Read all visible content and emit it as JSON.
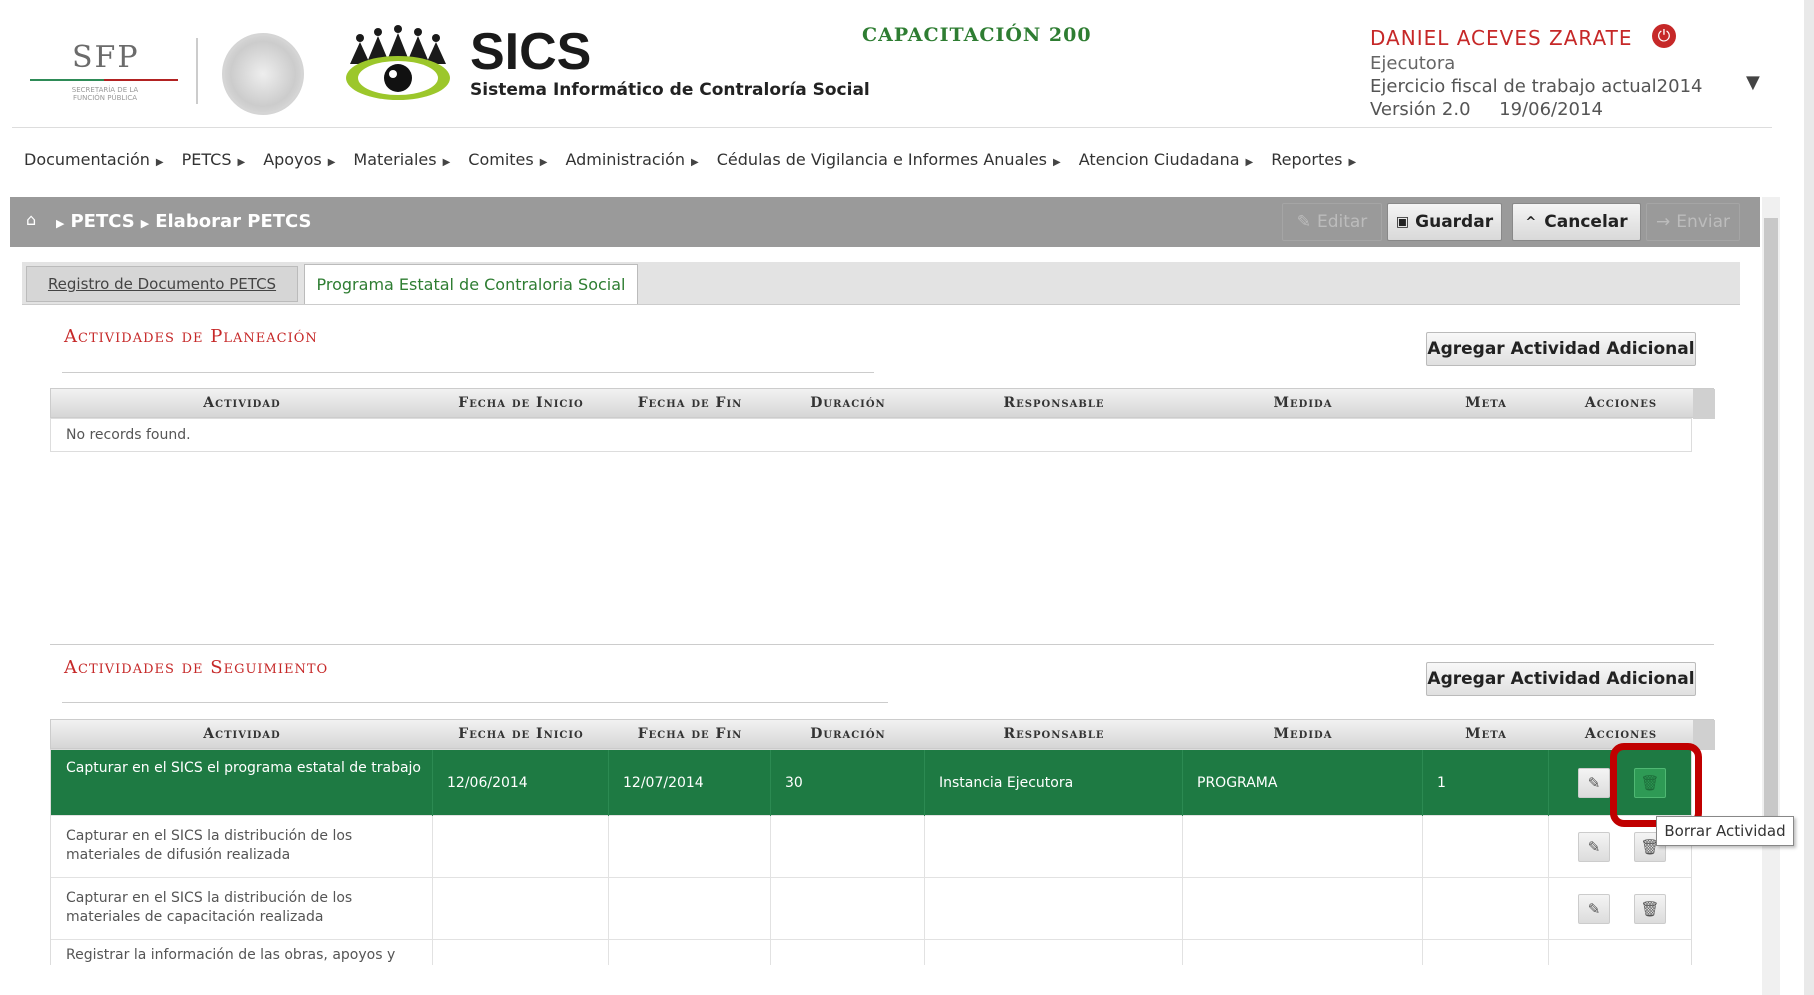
{
  "header": {
    "sfp_logo": "SFP",
    "sfp_subtitle": "SECRETARÍA DE LA FUNCIÓN PÚBLICA",
    "app_name": "SICS",
    "app_subtitle": "Sistema Informático de Contraloría Social",
    "environment": "CAPACITACIÓN 200"
  },
  "user": {
    "name": "DANIEL ACEVES ZARATE",
    "role": "Ejecutora",
    "fiscal": "Ejercicio fiscal de trabajo actual2014",
    "version": "Versión 2.0     19/06/2014"
  },
  "menu": [
    "Documentación",
    "PETCS",
    "Apoyos",
    "Materiales",
    "Comites",
    "Administración",
    "Cédulas de Vigilancia e Informes Anuales",
    "Atencion Ciudadana",
    "Reportes"
  ],
  "breadcrumb": {
    "level1": "PETCS",
    "level2": "Elaborar PETCS"
  },
  "toolbar": {
    "editar": "Editar",
    "guardar": "Guardar",
    "cancelar": "Cancelar",
    "enviar": "Enviar"
  },
  "tabs": {
    "tab1": "Registro de Documento PETCS",
    "tab2": "Programa Estatal de Contraloria Social"
  },
  "columns": [
    "Actividad",
    "Fecha de Inicio",
    "Fecha de Fin",
    "Duración",
    "Responsable",
    "Medida",
    "Meta",
    "Acciones"
  ],
  "planeacion": {
    "title": "Actividades de Planeación",
    "add_button": "Agregar Actividad Adicional",
    "empty": "No records found."
  },
  "seguimiento": {
    "title": "Actividades de Seguimiento",
    "add_button": "Agregar Actividad Adicional",
    "rows": [
      {
        "actividad": "Capturar en el SICS el programa estatal de trabajo",
        "inicio": "12/06/2014",
        "fin": "12/07/2014",
        "duracion": "30",
        "responsable": "Instancia Ejecutora",
        "medida": "PROGRAMA",
        "meta": "1"
      },
      {
        "actividad": "Capturar en el SICS la distribución de los materiales de difusión realizada",
        "inicio": "",
        "fin": "",
        "duracion": "",
        "responsable": "",
        "medida": "",
        "meta": ""
      },
      {
        "actividad": "Capturar en el SICS la distribución de los materiales de capacitación realizada",
        "inicio": "",
        "fin": "",
        "duracion": "",
        "responsable": "",
        "medida": "",
        "meta": ""
      },
      {
        "actividad": "Registrar la información de las obras, apoyos y",
        "inicio": "",
        "fin": "",
        "duracion": "",
        "responsable": "",
        "medida": "",
        "meta": ""
      }
    ]
  },
  "tooltip": "Borrar Actividad",
  "colors": {
    "selected_row": "#1e7a43",
    "accent_red": "#c62828",
    "accent_green": "#2e7d32"
  }
}
